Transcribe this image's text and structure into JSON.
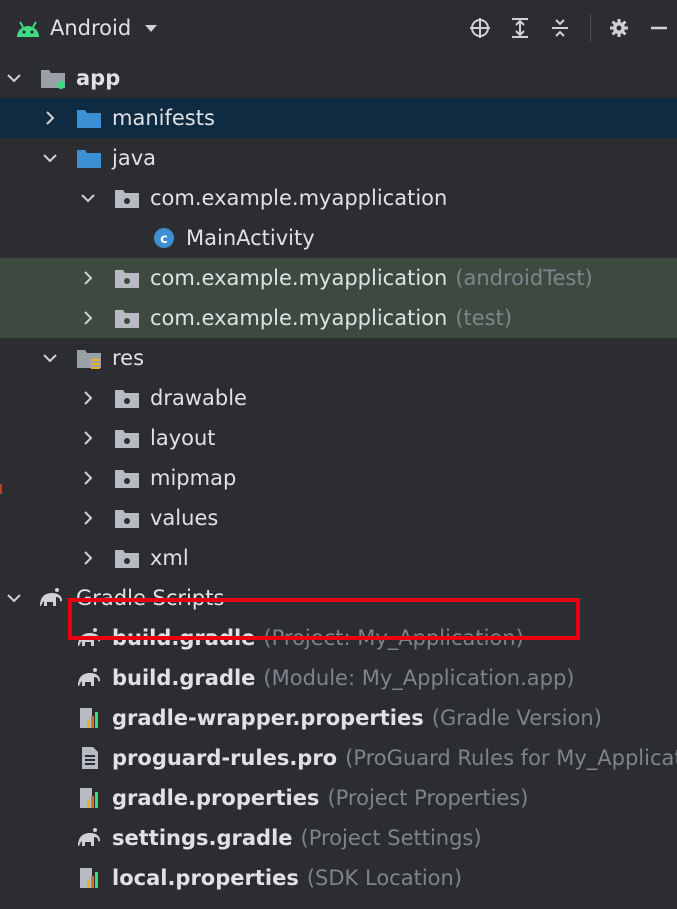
{
  "toolbar": {
    "title": "Android",
    "icons": [
      "android-icon",
      "dropdown-caret-icon",
      "locate-icon",
      "expand-all-icon",
      "collapse-all-icon",
      "gear-icon",
      "minimize-icon"
    ]
  },
  "tree": [
    {
      "label": "app",
      "secondary": ""
    },
    {
      "label": "manifests",
      "secondary": ""
    },
    {
      "label": "java",
      "secondary": ""
    },
    {
      "label": "com.example.myapplication",
      "secondary": ""
    },
    {
      "label": "MainActivity",
      "secondary": ""
    },
    {
      "label": "com.example.myapplication",
      "secondary": "(androidTest)"
    },
    {
      "label": "com.example.myapplication",
      "secondary": "(test)"
    },
    {
      "label": "res",
      "secondary": ""
    },
    {
      "label": "drawable",
      "secondary": ""
    },
    {
      "label": "layout",
      "secondary": ""
    },
    {
      "label": "mipmap",
      "secondary": ""
    },
    {
      "label": "values",
      "secondary": ""
    },
    {
      "label": "xml",
      "secondary": ""
    },
    {
      "label": "Gradle Scripts",
      "secondary": ""
    },
    {
      "label": "build.gradle",
      "secondary": "(Project: My_Application)"
    },
    {
      "label": "build.gradle",
      "secondary": "(Module: My_Application.app)"
    },
    {
      "label": "gradle-wrapper.properties",
      "secondary": "(Gradle Version)"
    },
    {
      "label": "proguard-rules.pro",
      "secondary": "(ProGuard Rules for My_Applicati"
    },
    {
      "label": "gradle.properties",
      "secondary": "(Project Properties)"
    },
    {
      "label": "settings.gradle",
      "secondary": "(Project Settings)"
    },
    {
      "label": "local.properties",
      "secondary": "(SDK Location)"
    }
  ],
  "colors": {
    "background": "#2b2d30",
    "selected_row": "#0f2b41",
    "test_row": "#3c4a3f",
    "folder_blue": "#3d8fd4",
    "android_green": "#3ddc84",
    "highlight_box": "#e8000e",
    "secondary_text": "#7f848b"
  }
}
